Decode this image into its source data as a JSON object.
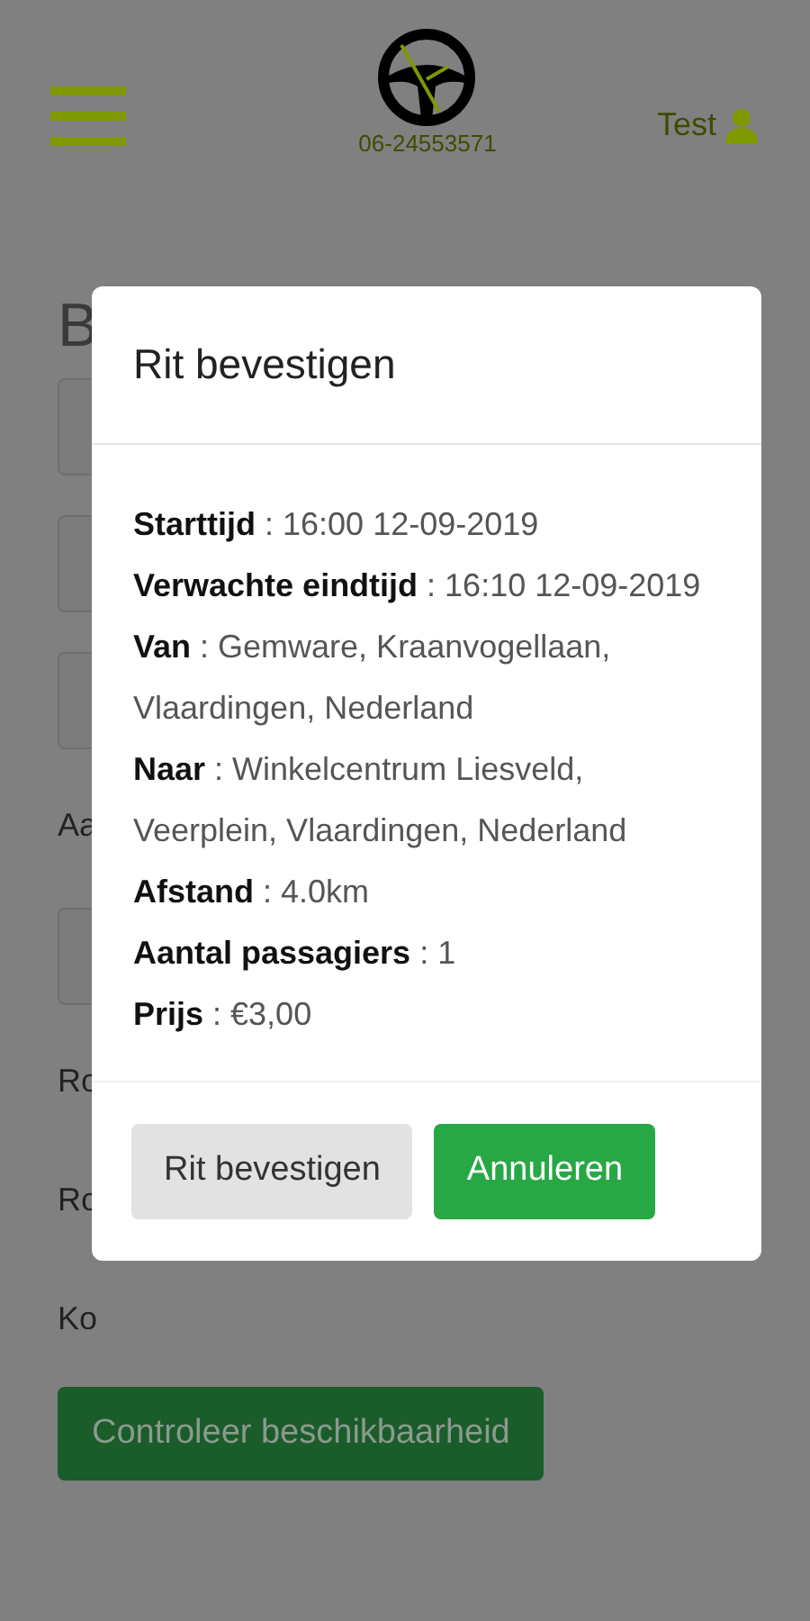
{
  "header": {
    "phone": "06-24553571",
    "user": "Test"
  },
  "background": {
    "heading": "B",
    "items": [
      {
        "kind": "field"
      },
      {
        "kind": "field"
      },
      {
        "kind": "field"
      },
      {
        "kind": "label",
        "text": "Aa"
      },
      {
        "kind": "field"
      },
      {
        "kind": "label",
        "text": "Ro"
      },
      {
        "kind": "label",
        "text": "Ro"
      },
      {
        "kind": "label",
        "text": "Ko"
      }
    ],
    "button": "Controleer beschikbaarheid"
  },
  "modal": {
    "title": "Rit bevestigen",
    "details": [
      "**Starttijd** : 16:00 12-09-2019",
      "**Verwachte eindtijd** : 16:10 12-09-2019",
      "**Van** : Gemware, Kraanvogellaan, Vlaardingen, Nederland",
      "**Naar** : Winkelcentrum Liesveld, Veerplein, Vlaardingen, Nederland",
      "**Afstand** : 4.0km",
      "**Aantal passagiers** : 1",
      "**Prijs** : €3,00"
    ],
    "buttons": [
      {
        "label": "Rit bevestigen",
        "kind": "secondary"
      },
      {
        "label": "Annuleren",
        "kind": "primary"
      }
    ]
  }
}
